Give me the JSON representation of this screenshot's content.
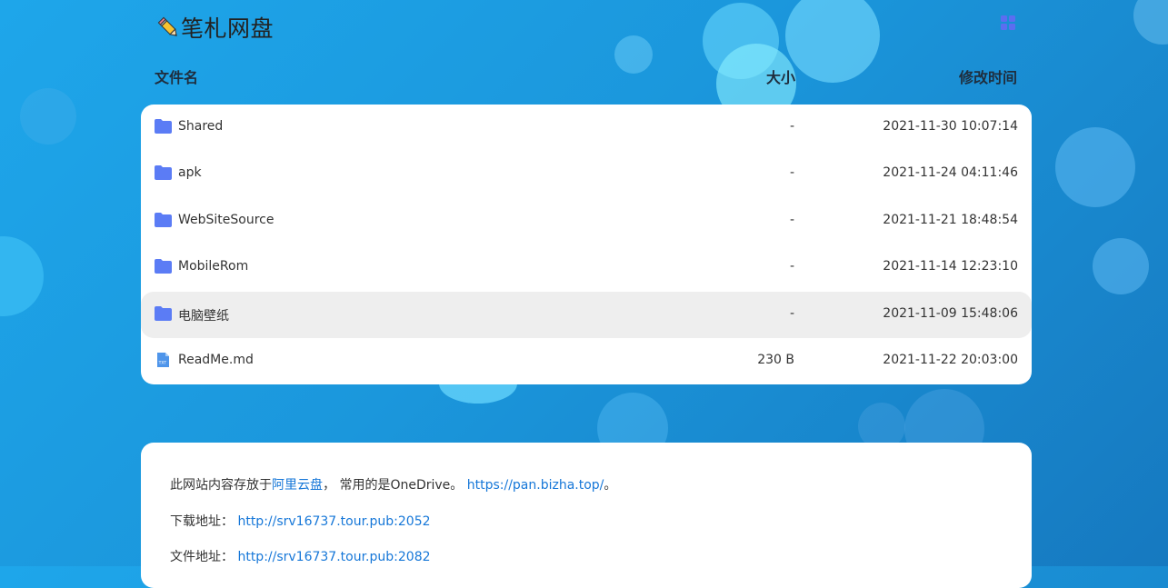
{
  "colors": {
    "accent": "#1677d8",
    "folder": "#5b7cf5",
    "background": "#1ea6ea",
    "row_highlight": "#eeeeee"
  },
  "header": {
    "title": "笔札网盘",
    "logo_icon": "pencil-icon",
    "view_toggle_icon": "grid-view-icon"
  },
  "columns": {
    "name": "文件名",
    "size": "大小",
    "modified": "修改时间"
  },
  "files": [
    {
      "name": "Shared",
      "size": "-",
      "modified": "2021-11-30 10:07:14",
      "icon": "folder-icon"
    },
    {
      "name": "apk",
      "size": "-",
      "modified": "2021-11-24 04:11:46",
      "icon": "folder-icon"
    },
    {
      "name": "WebSiteSource",
      "size": "-",
      "modified": "2021-11-21 18:48:54",
      "icon": "folder-icon"
    },
    {
      "name": "MobileRom",
      "size": "-",
      "modified": "2021-11-14 12:23:10",
      "icon": "folder-icon"
    },
    {
      "name": "电脑壁纸",
      "size": "-",
      "modified": "2021-11-09 15:48:06",
      "icon": "folder-icon"
    },
    {
      "name": "ReadMe.md",
      "size": "230 B",
      "modified": "2021-11-22 20:03:00",
      "icon": "text-file-icon"
    }
  ],
  "readme": {
    "line1": {
      "prefix": "此网站内容存放于",
      "link1": "阿里云盘",
      "middle": "， 常用的是OneDrive。 ",
      "link2": "https://pan.bizha.top/",
      "suffix": "。"
    },
    "line2": {
      "label": "下载地址： ",
      "link": "http://srv16737.tour.pub:2052"
    },
    "line3": {
      "label": "文件地址： ",
      "link": "http://srv16737.tour.pub:2082"
    }
  }
}
